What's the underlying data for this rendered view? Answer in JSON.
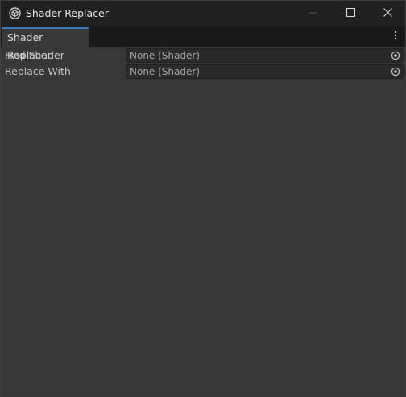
{
  "window": {
    "title": "Shader Replacer",
    "app_icon": "unity-icon",
    "controls": [
      "minimize-icon",
      "maximize-icon",
      "close-icon"
    ]
  },
  "tabs": [
    {
      "label": "Shader Replacer",
      "active": true
    }
  ],
  "fields": [
    {
      "label": "Find Shader",
      "value": "None (Shader)"
    },
    {
      "label": "Replace With",
      "value": "None (Shader)"
    }
  ],
  "colors": {
    "titlebar": "#202020",
    "panel": "#383838",
    "field_bg": "#2a2a2a",
    "tab_accent": "#3a79bb"
  }
}
